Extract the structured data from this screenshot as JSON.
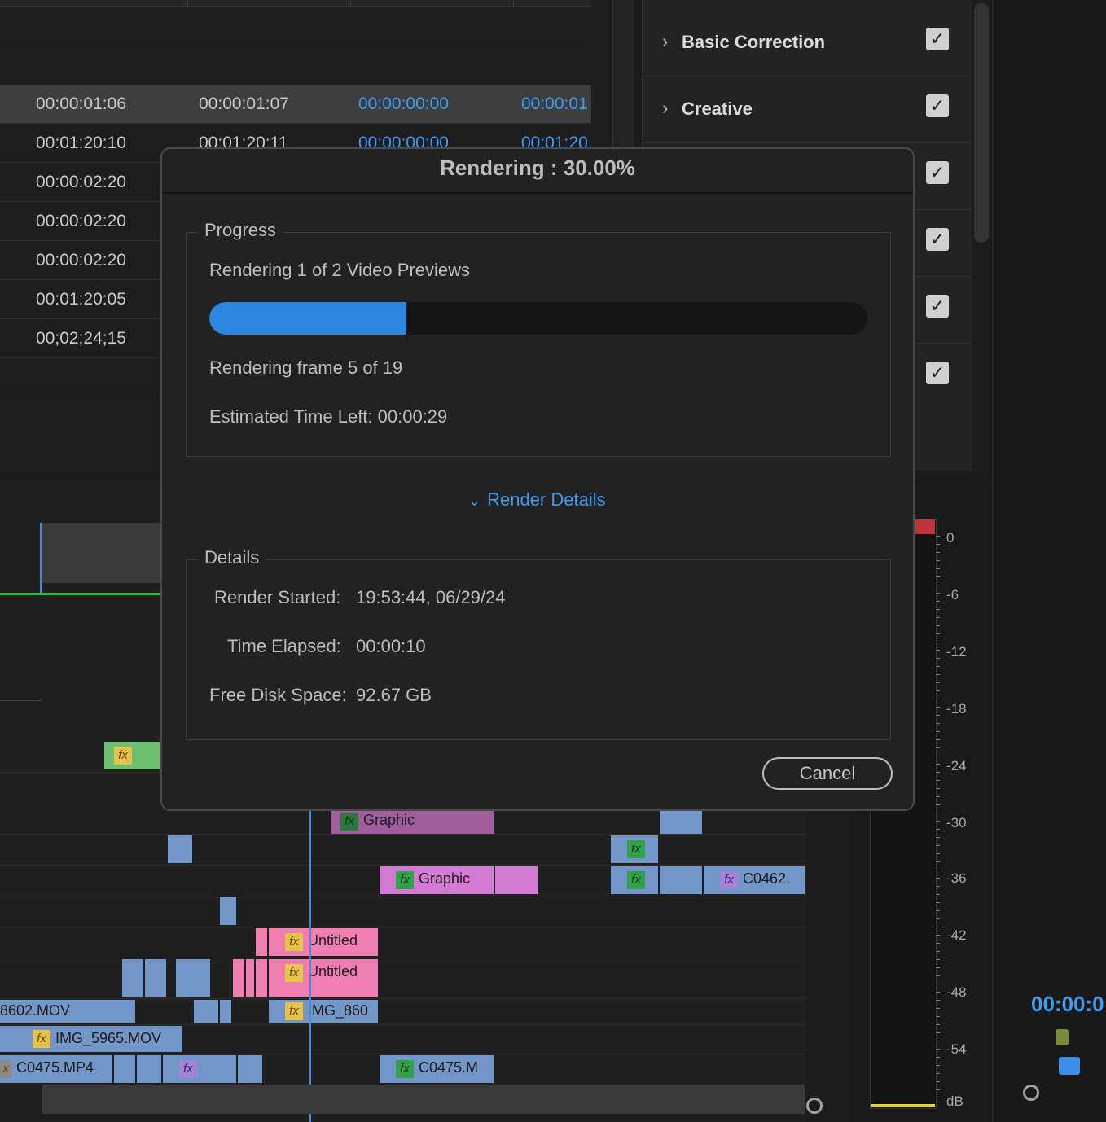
{
  "metadata_table": {
    "rows": [
      {
        "c1": "00:00:01:06",
        "c2": "00:00:01:07",
        "c3": "00:00:00:00",
        "c4": "00:00:01",
        "selected": true
      },
      {
        "c1": "00:01:20:10",
        "c2": "00:01:20:11",
        "c3": "00:00:00:00",
        "c4": "00:01:20"
      },
      {
        "c1": "00:00:02:20",
        "c2": "",
        "c3": "",
        "c4": ""
      },
      {
        "c1": "00:00:02:20",
        "c2": "",
        "c3": "",
        "c4": ""
      },
      {
        "c1": "00:00:02:20",
        "c2": "",
        "c3": "",
        "c4": ""
      },
      {
        "c1": "00:01:20:05",
        "c2": "",
        "c3": "",
        "c4": ""
      },
      {
        "c1": "00;02;24;15",
        "c2": "",
        "c3": "",
        "c4": ""
      }
    ]
  },
  "lumetri": {
    "sections": [
      {
        "label": "Basic Correction",
        "checked": true
      },
      {
        "label": "Creative",
        "checked": true
      },
      {
        "label": "",
        "checked": true
      },
      {
        "label": "",
        "checked": true
      },
      {
        "label": "",
        "checked": true
      },
      {
        "label": "",
        "checked": true
      }
    ]
  },
  "timeline": {
    "clips": {
      "graphic_1": "Graphic",
      "graphic_2": "Graphic",
      "c0462": "C0462.",
      "untitled_1": "Untitled",
      "untitled_2": "Untitled",
      "mov_8602": "8602.MOV",
      "img_860": "IMG_860",
      "img_5965": "IMG_5965.MOV",
      "c0475_mp4": "C0475.MP4",
      "c0475_m": "C0475.M"
    }
  },
  "meter": {
    "labels": [
      "0",
      "-6",
      "-12",
      "-18",
      "-24",
      "-30",
      "-36",
      "-42",
      "-48",
      "-54",
      "dB"
    ]
  },
  "program_timecode": "00:00:0",
  "dialog": {
    "title": "Rendering : 30.00%",
    "progress_legend": "Progress",
    "status": "Rendering 1 of 2 Video Previews",
    "progress_fraction": 0.3,
    "frame_status": "Rendering frame 5 of 19",
    "estimated_time": "Estimated Time Left: 00:00:29",
    "render_details_link": "Render Details",
    "details_legend": "Details",
    "details": {
      "render_started_label": "Render Started:",
      "render_started_value": "19:53:44, 06/29/24",
      "time_elapsed_label": "Time Elapsed:",
      "time_elapsed_value": "00:00:10",
      "free_disk_label": "Free Disk Space:",
      "free_disk_value": "92.67 GB"
    },
    "cancel_label": "Cancel"
  },
  "colors": {
    "accent_blue": "#3d9bf0",
    "progress_fill": "#2d86e0",
    "clip_blue": "#7396c9",
    "clip_pink": "#ee7fb0",
    "clip_magenta": "#d47ad4",
    "meter_peak": "#c0353b"
  }
}
